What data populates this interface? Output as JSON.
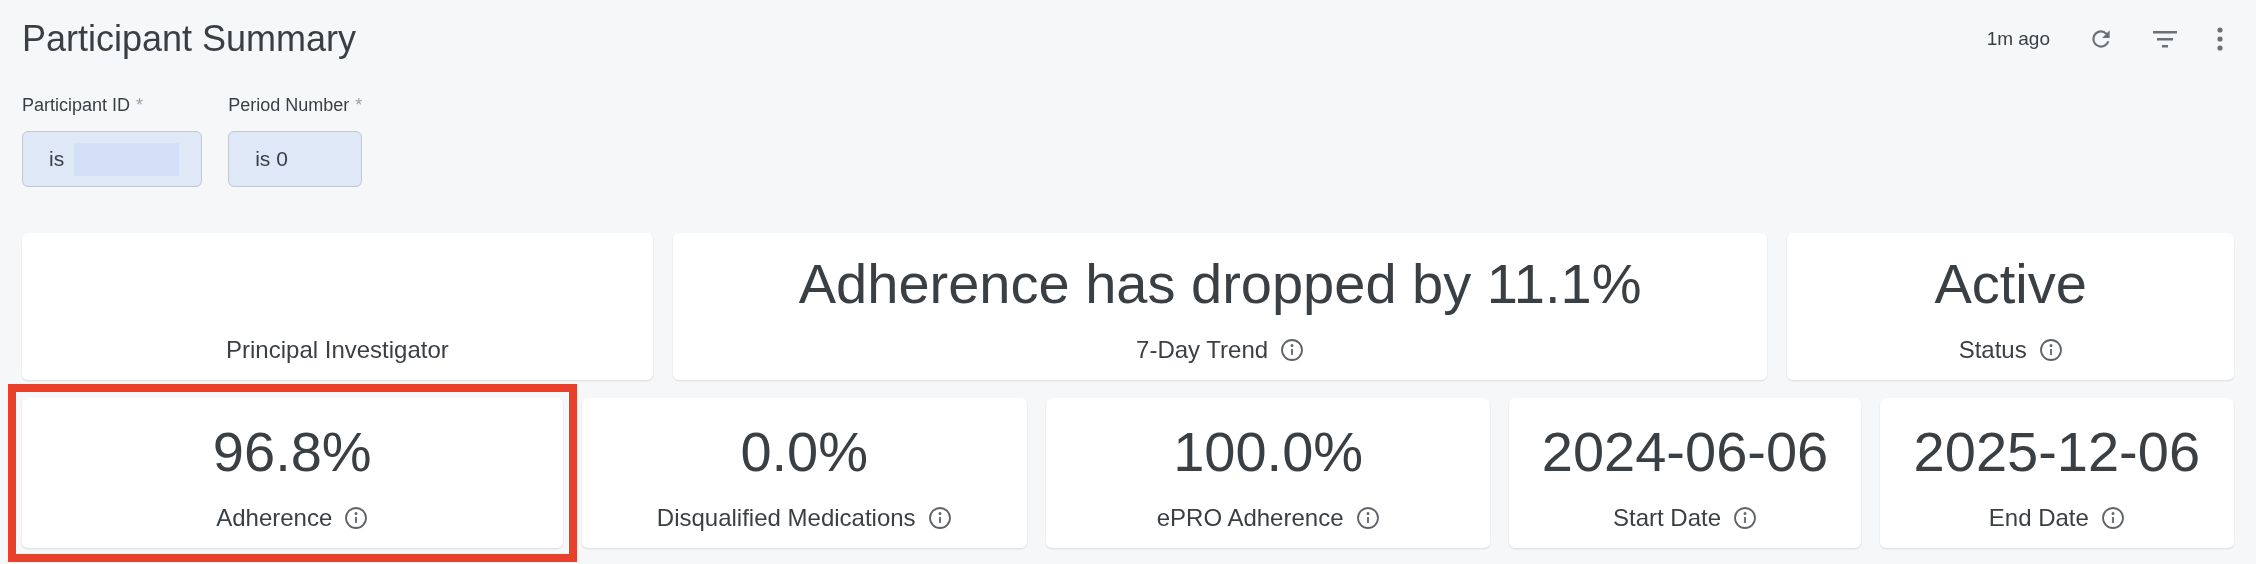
{
  "header": {
    "title": "Participant Summary",
    "updated": "1m ago"
  },
  "filters": [
    {
      "label": "Participant ID",
      "required_mark": "*",
      "value": "is",
      "redacted": true
    },
    {
      "label": "Period Number",
      "required_mark": "*",
      "value": "is 0",
      "redacted": false
    }
  ],
  "top_cards": [
    {
      "label": "Principal Investigator",
      "info": false
    },
    {
      "value": "Adherence has dropped by 11.1%",
      "label": "7-Day Trend",
      "info": true
    },
    {
      "value": "Active",
      "label": "Status",
      "info": true
    }
  ],
  "bottom_cards": [
    {
      "value": "96.8%",
      "label": "Adherence",
      "info": true,
      "highlighted": true
    },
    {
      "value": "0.0%",
      "label": "Disqualified Medications",
      "info": true,
      "highlighted": false
    },
    {
      "value": "100.0%",
      "label": "ePRO Adherence",
      "info": true,
      "highlighted": false
    },
    {
      "value": "2024-06-06",
      "label": "Start Date",
      "info": true,
      "highlighted": false
    },
    {
      "value": "2025-12-06",
      "label": "End Date",
      "info": true,
      "highlighted": false
    }
  ]
}
